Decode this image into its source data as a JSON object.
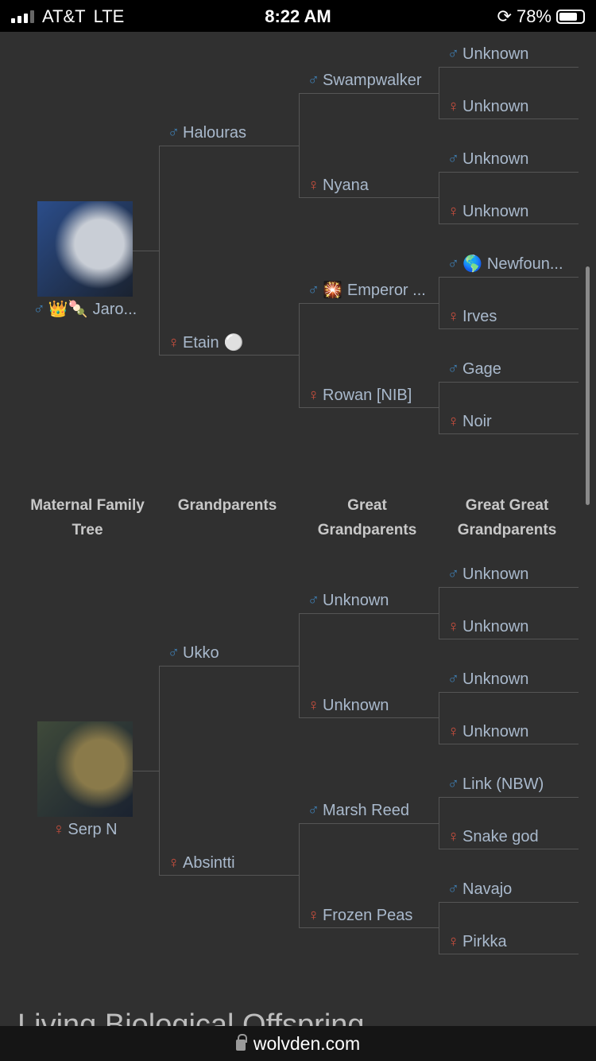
{
  "status_bar": {
    "carrier": "AT&T",
    "network": "LTE",
    "time": "8:22 AM",
    "battery": "78%",
    "battery_level": 0.78
  },
  "headers": [
    "Maternal Family\nTree",
    "Grandparents",
    "Great\nGrandparents",
    "Great Great\nGrandparents"
  ],
  "trees": [
    {
      "subject": {
        "sex": "m",
        "emoji": "👑🍡",
        "name": "Jaro...",
        "image": "blue-white-wolf",
        "image_colors": [
          "#2b4d8a",
          "#c9ced6"
        ]
      },
      "gen2": [
        {
          "sex": "m",
          "name": "Halouras"
        },
        {
          "sex": "f",
          "name": "Etain",
          "emoji_after": "⚪"
        }
      ],
      "gen3": [
        {
          "sex": "m",
          "name": "Swampwalker"
        },
        {
          "sex": "f",
          "name": "Nyana"
        },
        {
          "sex": "m",
          "emoji": "🎇",
          "name": "Emperor ..."
        },
        {
          "sex": "f",
          "name": "Rowan [NIB]"
        }
      ],
      "gen4": [
        {
          "sex": "m",
          "name": "Unknown"
        },
        {
          "sex": "f",
          "name": "Unknown"
        },
        {
          "sex": "m",
          "name": "Unknown"
        },
        {
          "sex": "f",
          "name": "Unknown"
        },
        {
          "sex": "m",
          "emoji": "🌎",
          "name": "Newfoun..."
        },
        {
          "sex": "f",
          "name": "Irves"
        },
        {
          "sex": "m",
          "name": "Gage"
        },
        {
          "sex": "f",
          "name": "Noir"
        }
      ]
    },
    {
      "subject": {
        "sex": "f",
        "name": "Serp N",
        "image": "brown-wolf",
        "image_colors": [
          "#3f4a3a",
          "#8a7a4a"
        ]
      },
      "gen2": [
        {
          "sex": "m",
          "name": "Ukko"
        },
        {
          "sex": "f",
          "name": "Absintti"
        }
      ],
      "gen3": [
        {
          "sex": "m",
          "name": "Unknown"
        },
        {
          "sex": "f",
          "name": "Unknown"
        },
        {
          "sex": "m",
          "name": "Marsh Reed"
        },
        {
          "sex": "f",
          "name": "Frozen Peas"
        }
      ],
      "gen4": [
        {
          "sex": "m",
          "name": "Unknown"
        },
        {
          "sex": "f",
          "name": "Unknown"
        },
        {
          "sex": "m",
          "name": "Unknown"
        },
        {
          "sex": "f",
          "name": "Unknown"
        },
        {
          "sex": "m",
          "name": "Link (NBW)"
        },
        {
          "sex": "f",
          "name": "Snake god"
        },
        {
          "sex": "m",
          "name": "Navajo"
        },
        {
          "sex": "f",
          "name": "Pirkka"
        }
      ]
    }
  ],
  "section_title": "Living Biological Offspring",
  "url": "wolvden.com",
  "colors": {
    "background": "#303030",
    "male": "#3f7fb4",
    "female": "#d0503e",
    "text": "#a9b9cc"
  }
}
